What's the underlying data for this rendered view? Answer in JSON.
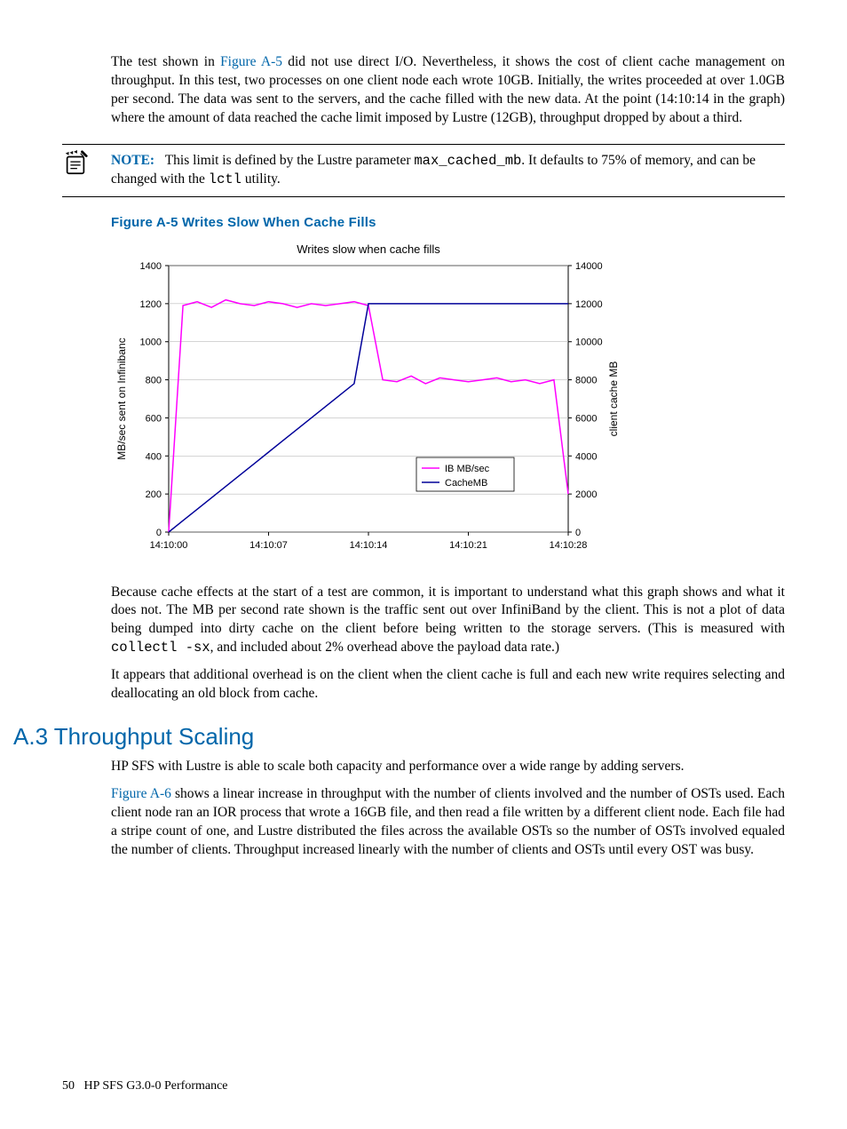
{
  "para1_a": "The test shown in ",
  "para1_link": "Figure A-5",
  "para1_b": " did not use direct I/O. Nevertheless, it shows the cost of client cache management on throughput. In this test, two processes on one client node each wrote 10GB. Initially, the writes proceeded at over 1.0GB per second. The data was sent to the servers, and the cache filled with the new data. At the point (14:10:14 in the graph) where the amount of data reached the cache limit imposed by Lustre (12GB), throughput dropped by about a third.",
  "note_label": "NOTE:",
  "note_a": "This limit is defined by the Lustre parameter ",
  "note_code1": "max_cached_mb",
  "note_b": ". It defaults to 75% of memory, and can be changed with the ",
  "note_code2": "lctl",
  "note_c": " utility.",
  "figure_caption": "Figure A-5 Writes Slow When Cache Fills",
  "para2_a": "Because cache effects at the start of a test are common, it is important to understand what this graph shows and what it does not. The MB per second rate shown is the traffic sent out over InfiniBand by the client. This is not a plot of data being dumped into dirty cache on the client before being written to the storage servers. (This is measured with ",
  "para2_code": "collectl -sx",
  "para2_b": ", and included about 2% overhead above the payload data rate.)",
  "para3": "It appears that additional overhead is on the client when the client cache is full and each new write requires selecting and deallocating an old block from cache.",
  "section_head": "A.3 Throughput Scaling",
  "para4": "HP SFS with Lustre is able to scale both capacity and performance over a wide range by adding servers.",
  "para5_link": "Figure A-6",
  "para5_b": " shows a linear increase in throughput with the number of clients involved and the number of OSTs used. Each client node ran an IOR process that wrote a 16GB file, and then read a file written by a different client node. Each file had a stripe count of one, and Lustre distributed the files across the available OSTs so the number of OSTs involved equaled the number of clients. Throughput increased linearly with the number of clients and OSTs until every OST was busy.",
  "footer_page": "50",
  "footer_text": "HP SFS G3.0-0 Performance",
  "chart_data": {
    "type": "line",
    "title": "Writes slow when cache fills",
    "xlabel": "",
    "ylabel_left": "MB/sec sent on Infinibanc",
    "ylabel_right": "client cache MB",
    "ylim_left": [
      0,
      1400
    ],
    "ylim_right": [
      0,
      14000
    ],
    "x_ticks": [
      "14:10:00",
      "14:10:07",
      "14:10:14",
      "14:10:21",
      "14:10:28"
    ],
    "y_ticks_left": [
      0,
      200,
      400,
      600,
      800,
      1000,
      1200,
      1400
    ],
    "y_ticks_right": [
      0,
      2000,
      4000,
      6000,
      8000,
      10000,
      12000,
      14000
    ],
    "series": [
      {
        "name": "IB MB/sec",
        "axis": "left",
        "color": "#ff00ff",
        "values": [
          0,
          1190,
          1210,
          1180,
          1220,
          1200,
          1190,
          1210,
          1200,
          1180,
          1200,
          1190,
          1200,
          1210,
          1190,
          800,
          790,
          820,
          780,
          810,
          800,
          790,
          800,
          810,
          790,
          800,
          780,
          800,
          200
        ]
      },
      {
        "name": "CacheMB",
        "axis": "right",
        "color": "#000099",
        "values": [
          0,
          600,
          1200,
          1800,
          2400,
          3000,
          3600,
          4200,
          4800,
          5400,
          6000,
          6600,
          7200,
          7800,
          12000,
          12000,
          12000,
          12000,
          12000,
          12000,
          12000,
          12000,
          12000,
          12000,
          12000,
          12000,
          12000,
          12000,
          12000
        ]
      }
    ],
    "n_points": 29,
    "legend": [
      "IB MB/sec",
      "CacheMB"
    ]
  }
}
